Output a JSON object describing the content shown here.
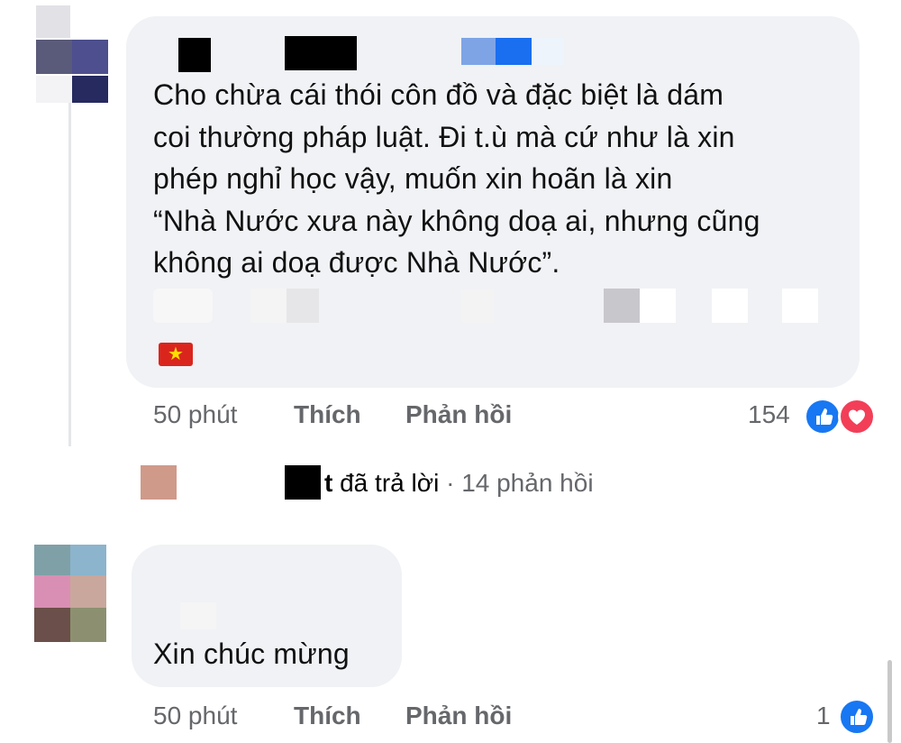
{
  "comment1": {
    "text_lines": [
      "Cho chừa cái thói côn đồ và đặc biệt là dám",
      "coi thường pháp luật. Đi t.ù mà cứ như là xin",
      "phép nghỉ học vậy, muốn xin hoãn là xin",
      "“Nhà Nước xưa này không doạ ai, nhưng cũng",
      "không ai doạ được Nhà Nước”."
    ],
    "flag_icon": "vietnam-flag-icon",
    "time": "50 phút",
    "like_label": "Thích",
    "reply_label": "Phản hồi",
    "reaction_count": "154",
    "reaction_icons": [
      "like-icon",
      "love-icon"
    ]
  },
  "reply_summary": {
    "name_suffix": "t",
    "text": "đã trả lời",
    "separator": "·",
    "count_text": "14 phản hồi"
  },
  "comment2": {
    "text": "Xin chúc mừng",
    "time": "50 phút",
    "like_label": "Thích",
    "reply_label": "Phản hồi",
    "reaction_count": "1",
    "reaction_icons": [
      "like-icon"
    ]
  },
  "colors": {
    "bubble_bg": "#f0f2f5",
    "meta_text": "#65676b",
    "like_blue": "#1877f2",
    "love_red": "#f33e58"
  }
}
